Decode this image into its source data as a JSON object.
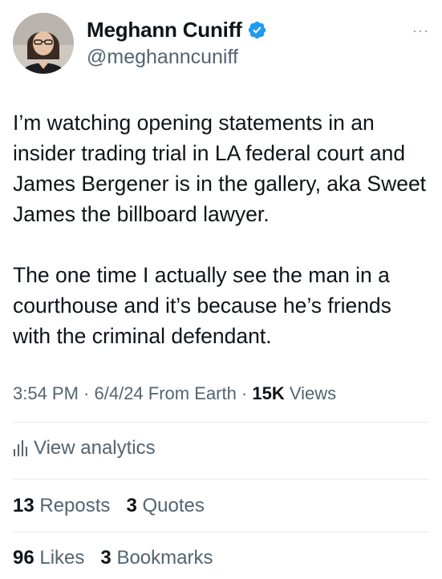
{
  "author": {
    "display_name": "Meghann Cuniff",
    "handle": "@meghanncuniff",
    "verified": true,
    "avatar_icon": "profile-photo"
  },
  "more_label": "···",
  "tweet": {
    "paragraphs": [
      "I’m watching opening statements in an insider trading trial in LA federal court and James Bergener is in the gallery, aka Sweet James the billboard lawyer.",
      "The one time I actually see the man in a courthouse and it’s because he’s friends with the criminal defendant."
    ]
  },
  "meta": {
    "time": "3:54 PM",
    "sep1": " · ",
    "date": "6/4/24",
    "source": " From Earth",
    "sep2": " · ",
    "views_count": "15K",
    "views_label": " Views"
  },
  "analytics": {
    "label": "View analytics",
    "icon": "bar-chart-icon"
  },
  "stats": {
    "reposts_count": "13",
    "reposts_label": " Reposts",
    "quotes_count": "3",
    "quotes_label": " Quotes",
    "likes_count": "96",
    "likes_label": " Likes",
    "bookmarks_count": "3",
    "bookmarks_label": " Bookmarks"
  },
  "colors": {
    "verified_blue": "#1d9bf0",
    "secondary_text": "#536471",
    "primary_text": "#0f1419",
    "divider": "#e6ecf0"
  }
}
